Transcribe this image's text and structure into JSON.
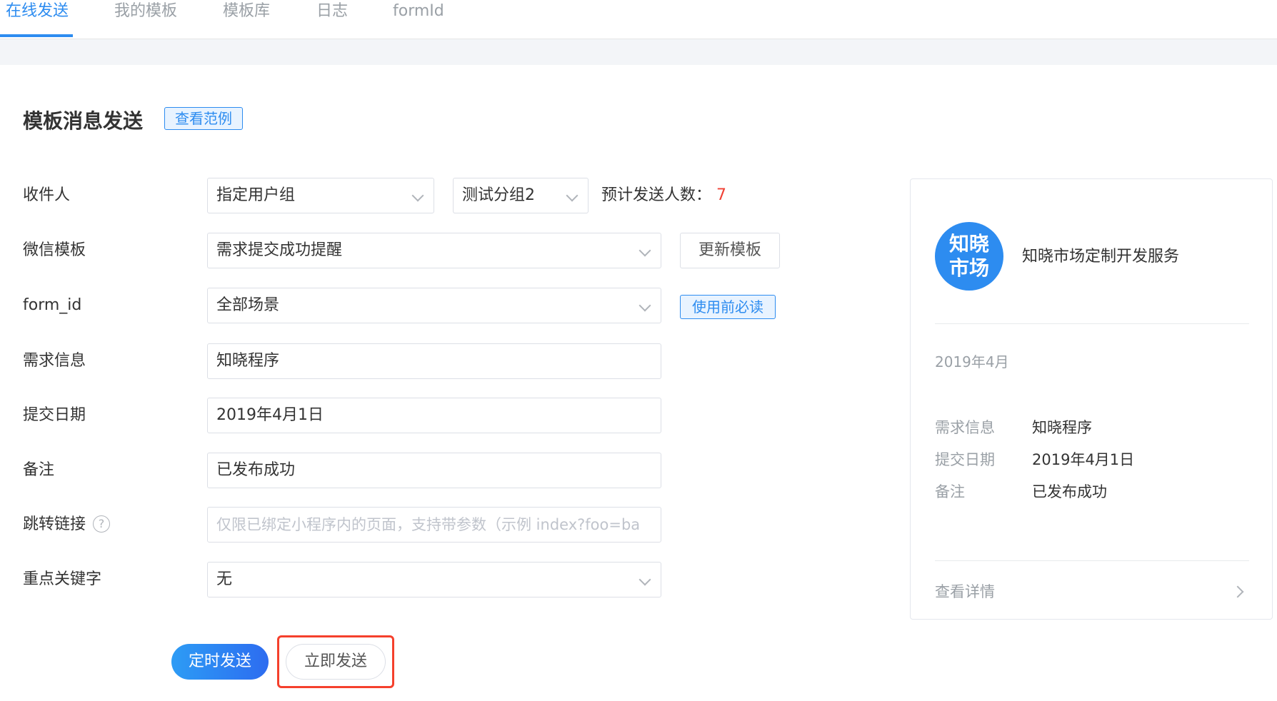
{
  "tabs": [
    "在线发送",
    "我的模板",
    "模板库",
    "日志",
    "formId"
  ],
  "page": {
    "title": "模板消息发送",
    "example_btn": "查看范例"
  },
  "form": {
    "recipient": {
      "label": "收件人",
      "group_type": "指定用户组",
      "group": "测试分组2",
      "count_label": "预计发送人数：",
      "count": "7"
    },
    "template": {
      "label": "微信模板",
      "value": "需求提交成功提醒",
      "update_btn": "更新模板"
    },
    "form_id": {
      "label": "form_id",
      "value": "全部场景",
      "must_read_btn": "使用前必读"
    },
    "demand": {
      "label": "需求信息",
      "value": "知晓程序"
    },
    "date": {
      "label": "提交日期",
      "value": "2019年4月1日"
    },
    "note": {
      "label": "备注",
      "value": "已发布成功"
    },
    "link": {
      "label": "跳转链接",
      "help": "?",
      "placeholder": "仅限已绑定小程序内的页面，支持带参数（示例 index?foo=ba"
    },
    "keyword": {
      "label": "重点关键字",
      "value": "无"
    }
  },
  "actions": {
    "scheduled": "定时发送",
    "now": "立即发送"
  },
  "preview": {
    "logo_line1": "知晓",
    "logo_line2": "市场",
    "brand": "知晓市场定制开发服务",
    "date": "2019年4月",
    "rows": [
      {
        "key": "需求信息",
        "value": "知晓程序"
      },
      {
        "key": "提交日期",
        "value": "2019年4月1日"
      },
      {
        "key": "备注",
        "value": "已发布成功"
      }
    ],
    "detail": "查看详情"
  },
  "colors": {
    "accent": "#2d8cf0",
    "count": "#f04134",
    "highlight": "#f5402c"
  }
}
